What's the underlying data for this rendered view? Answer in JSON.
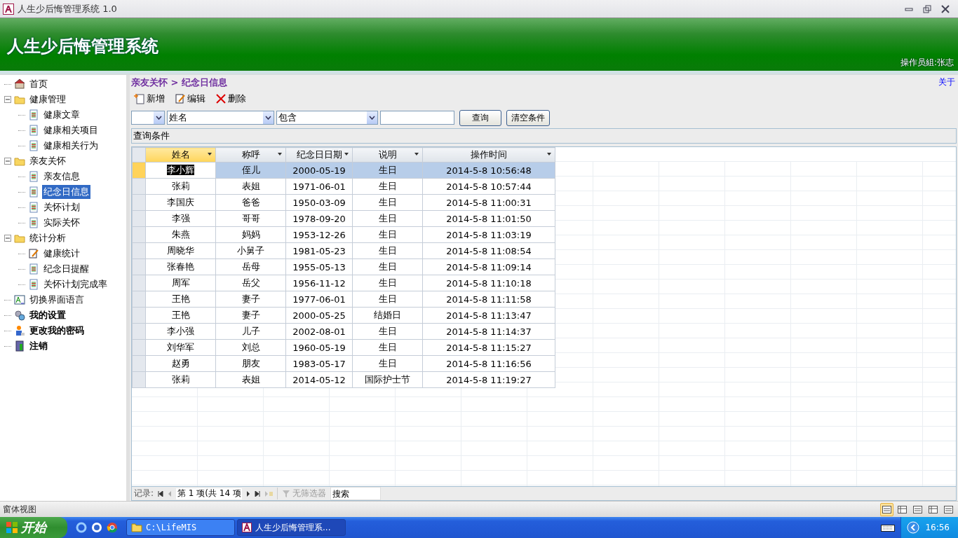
{
  "window": {
    "title": "人生少后悔管理系统 1.0"
  },
  "banner": {
    "title": "人生少后悔管理系统",
    "operator": "操作员組:张志"
  },
  "about_link": "关于",
  "sidebar": {
    "items": [
      {
        "label": "首页",
        "kind": "home",
        "emphasized": false,
        "selected": false
      },
      {
        "label": "健康管理",
        "kind": "folder",
        "emphasized": false,
        "selected": false,
        "expanded": true,
        "children": [
          {
            "label": "健康文章",
            "kind": "doc",
            "emphasized": false,
            "selected": false
          },
          {
            "label": "健康相关项目",
            "kind": "doc",
            "emphasized": false,
            "selected": false
          },
          {
            "label": "健康相关行为",
            "kind": "doc",
            "emphasized": false,
            "selected": false
          }
        ]
      },
      {
        "label": "亲友关怀",
        "kind": "folder",
        "emphasized": false,
        "selected": false,
        "expanded": true,
        "children": [
          {
            "label": "亲友信息",
            "kind": "doc",
            "emphasized": false,
            "selected": false
          },
          {
            "label": "纪念日信息",
            "kind": "doc",
            "emphasized": false,
            "selected": true
          },
          {
            "label": "关怀计划",
            "kind": "doc",
            "emphasized": false,
            "selected": false
          },
          {
            "label": "实际关怀",
            "kind": "doc",
            "emphasized": false,
            "selected": false
          }
        ]
      },
      {
        "label": "统计分析",
        "kind": "folder",
        "emphasized": false,
        "selected": false,
        "expanded": true,
        "children": [
          {
            "label": "健康统计",
            "kind": "edit",
            "emphasized": false,
            "selected": false
          },
          {
            "label": "纪念日提醒",
            "kind": "doc",
            "emphasized": false,
            "selected": false
          },
          {
            "label": "关怀计划完成率",
            "kind": "doc",
            "emphasized": false,
            "selected": false
          }
        ]
      },
      {
        "label": "切换界面语言",
        "kind": "language",
        "emphasized": false,
        "selected": false
      },
      {
        "label": "我的设置",
        "kind": "settings",
        "emphasized": true,
        "selected": false
      },
      {
        "label": "更改我的密码",
        "kind": "user",
        "emphasized": true,
        "selected": false
      },
      {
        "label": "注销",
        "kind": "logout",
        "emphasized": true,
        "selected": false
      }
    ]
  },
  "breadcrumb": "亲友关怀 > 纪念日信息",
  "toolbar": [
    {
      "label": "新增",
      "kind": "new"
    },
    {
      "label": "编辑",
      "kind": "edit"
    },
    {
      "label": "删除",
      "kind": "delete"
    }
  ],
  "filter": {
    "field": "姓名",
    "operator": "包含",
    "buttons": [
      "查询",
      "清空条件"
    ],
    "conditions_label": "查询条件"
  },
  "table": {
    "columns": [
      "姓名",
      "称呼",
      "纪念日日期",
      "说明",
      "操作时间"
    ],
    "rows": [
      {
        "selected": true,
        "cells": [
          "李小辉",
          "侄儿",
          "2000-05-19",
          "生日",
          "2014-5-8 10:56:48"
        ]
      },
      {
        "selected": false,
        "cells": [
          "张莉",
          "表姐",
          "1971-06-01",
          "生日",
          "2014-5-8 10:57:44"
        ]
      },
      {
        "selected": false,
        "cells": [
          "李国庆",
          "爸爸",
          "1950-03-09",
          "生日",
          "2014-5-8 11:00:31"
        ]
      },
      {
        "selected": false,
        "cells": [
          "李强",
          "哥哥",
          "1978-09-20",
          "生日",
          "2014-5-8 11:01:50"
        ]
      },
      {
        "selected": false,
        "cells": [
          "朱燕",
          "妈妈",
          "1953-12-26",
          "生日",
          "2014-5-8 11:03:19"
        ]
      },
      {
        "selected": false,
        "cells": [
          "周晓华",
          "小舅子",
          "1981-05-23",
          "生日",
          "2014-5-8 11:08:54"
        ]
      },
      {
        "selected": false,
        "cells": [
          "张春艳",
          "岳母",
          "1955-05-13",
          "生日",
          "2014-5-8 11:09:14"
        ]
      },
      {
        "selected": false,
        "cells": [
          "周军",
          "岳父",
          "1956-11-12",
          "生日",
          "2014-5-8 11:10:18"
        ]
      },
      {
        "selected": false,
        "cells": [
          "王艳",
          "妻子",
          "1977-06-01",
          "生日",
          "2014-5-8 11:11:58"
        ]
      },
      {
        "selected": false,
        "cells": [
          "王艳",
          "妻子",
          "2000-05-25",
          "结婚日",
          "2014-5-8 11:13:47"
        ]
      },
      {
        "selected": false,
        "cells": [
          "李小强",
          "儿子",
          "2002-08-01",
          "生日",
          "2014-5-8 11:14:37"
        ]
      },
      {
        "selected": false,
        "cells": [
          "刘华军",
          "刘总",
          "1960-05-19",
          "生日",
          "2014-5-8 11:15:27"
        ]
      },
      {
        "selected": false,
        "cells": [
          "赵勇",
          "朋友",
          "1983-05-17",
          "生日",
          "2014-5-8 11:16:56"
        ]
      },
      {
        "selected": false,
        "cells": [
          "张莉",
          "表姐",
          "2014-05-12",
          "国际护士节",
          "2014-5-8 11:19:27"
        ]
      }
    ]
  },
  "record_nav": {
    "label": "记录:",
    "position": "第 1 项(共 14 项",
    "filter": "无筛选器",
    "search_placeholder": "搜索"
  },
  "status_bar": {
    "text": "窗体视图",
    "views": [
      {
        "selected": true
      },
      {
        "selected": false
      },
      {
        "selected": false
      },
      {
        "selected": false
      },
      {
        "selected": false
      }
    ]
  },
  "taskbar": {
    "start": "开始",
    "tasks": [
      {
        "label": "C:\\LifeMIS",
        "kind": "folder",
        "selected": false
      },
      {
        "label": "人生少后悔管理系...",
        "kind": "app",
        "selected": true
      }
    ],
    "clock": "16:56"
  }
}
